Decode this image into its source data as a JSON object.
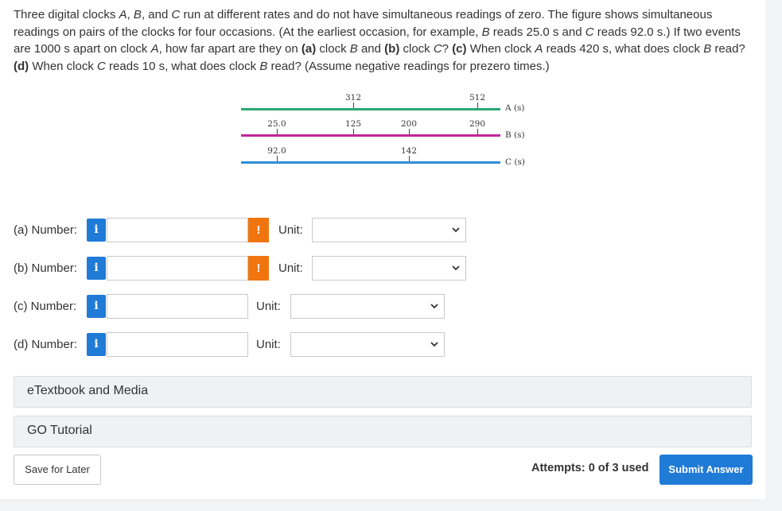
{
  "question": {
    "p1": "Three digital clocks ",
    "A": "A",
    "c1": ", ",
    "B": "B",
    "c2": ", and ",
    "C": "C",
    "p2": " run at different rates and do not have simultaneous readings of zero. The figure shows simultaneous readings on pairs of the clocks for four occasions. (At the earliest occasion, for example, ",
    "B2": "B",
    "p3": " reads 25.0 s and ",
    "C2": "C",
    "p4": " reads 92.0 s.) If two events are 1000 s apart on clock ",
    "A2": "A",
    "p5": ", how far apart are they on ",
    "a": "(a)",
    "p6": " clock ",
    "B3": "B",
    "p7": " and ",
    "b": "(b)",
    "p8": " clock ",
    "C3": "C",
    "p9": "? ",
    "c": "(c)",
    "p10": " When clock ",
    "A3": "A",
    "p11": " reads 420 s, what does clock ",
    "B4": "B",
    "p12": " read? ",
    "d": "(d)",
    "p13": " When clock ",
    "C4": "C",
    "p14": " reads 10 s, what does clock ",
    "B5": "B",
    "p15": " read? (Assume negative readings for prezero times.)"
  },
  "figure": {
    "a_readings": [
      "312",
      "512"
    ],
    "b_readings": [
      "25.0",
      "125",
      "200",
      "290"
    ],
    "c_readings": [
      "92.0",
      "142"
    ],
    "axis_a": "A (s)",
    "axis_b": "B (s)",
    "axis_c": "C (s)",
    "colors": {
      "A": "#2aa876",
      "B": "#c0249a",
      "C": "#2f8fd8"
    }
  },
  "answers": [
    {
      "label": "(a) Number:",
      "unit_label": "Unit:",
      "warning": "!",
      "info": "i"
    },
    {
      "label": "(b) Number:",
      "unit_label": "Unit:",
      "warning": "!",
      "info": "i"
    },
    {
      "label": "(c) Number:",
      "unit_label": "Unit:",
      "info": "i"
    },
    {
      "label": "(d) Number:",
      "unit_label": "Unit:",
      "info": "i"
    }
  ],
  "panels": {
    "etextbook": "eTextbook and Media",
    "go_tutorial": "GO Tutorial"
  },
  "footer": {
    "save": "Save for Later",
    "attempts": "Attempts: 0 of 3 used",
    "submit": "Submit Answer"
  }
}
